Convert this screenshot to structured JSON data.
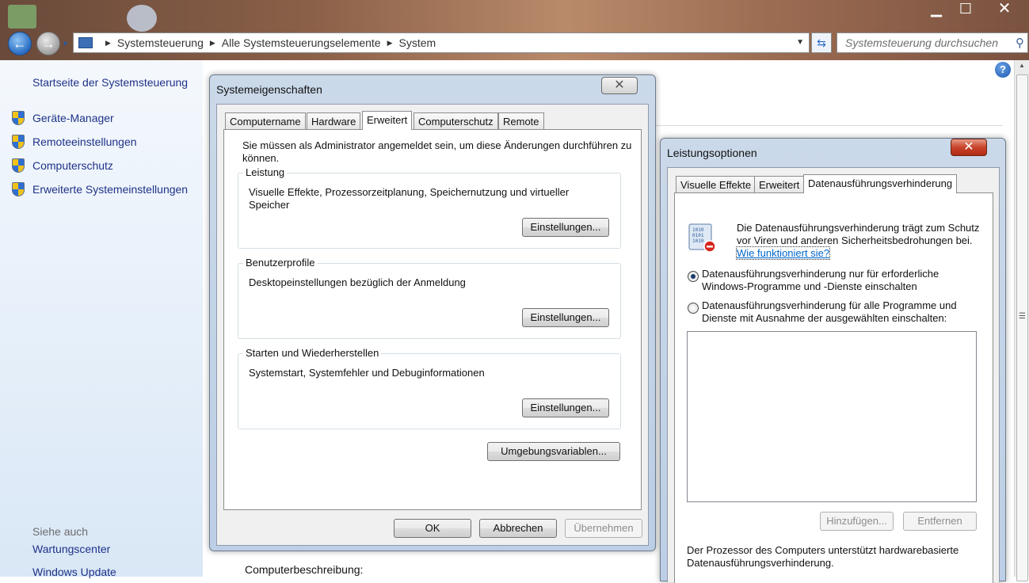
{
  "window": {
    "min_icon": "minimize-icon",
    "max_icon": "maximize-icon",
    "close_icon": "close-icon"
  },
  "addressbar": {
    "crumbs": [
      "Systemsteuerung",
      "Alle Systemsteuerungselemente",
      "System"
    ],
    "search_placeholder": "Systemsteuerung durchsuchen"
  },
  "leftpane": {
    "home": "Startseite der Systemsteuerung",
    "items": [
      "Geräte-Manager",
      "Remoteeinstellungen",
      "Computerschutz",
      "Erweiterte Systemeinstellungen"
    ],
    "see_also": "Siehe auch",
    "see_also_items": [
      "Wartungscenter",
      "Windows Update"
    ]
  },
  "main": {
    "computer_description_label": "Computerbeschreibung:"
  },
  "sysprops": {
    "title": "Systemeigenschaften",
    "tabs": [
      "Computername",
      "Hardware",
      "Erweitert",
      "Computerschutz",
      "Remote"
    ],
    "active_tab": "Erweitert",
    "admin_note": "Sie müssen als Administrator angemeldet sein, um diese Änderungen durchführen zu können.",
    "groups": [
      {
        "legend": "Leistung",
        "desc": "Visuelle Effekte, Prozessorzeitplanung, Speichernutzung und virtueller Speicher",
        "button": "Einstellungen..."
      },
      {
        "legend": "Benutzerprofile",
        "desc": "Desktopeinstellungen bezüglich der Anmeldung",
        "button": "Einstellungen..."
      },
      {
        "legend": "Starten und Wiederherstellen",
        "desc": "Systemstart, Systemfehler und Debuginformationen",
        "button": "Einstellungen..."
      }
    ],
    "env_button": "Umgebungsvariablen...",
    "ok": "OK",
    "cancel": "Abbrechen",
    "apply": "Übernehmen"
  },
  "perfopts": {
    "title": "Leistungsoptionen",
    "tabs": [
      "Visuelle Effekte",
      "Erweitert",
      "Datenausführungsverhinderung"
    ],
    "active_tab": "Datenausführungsverhinderung",
    "info_line1": "Die Datenausführungsverhinderung trägt zum Schutz",
    "info_line2": "vor Viren und anderen Sicherheitsbedrohungen bei.",
    "how_link": "Wie funktioniert sie?",
    "radio1_line1": "Datenausführungsverhinderung nur für erforderliche",
    "radio1_line2": "Windows-Programme und -Dienste einschalten",
    "radio2_line1": "Datenausführungsverhinderung für alle Programme und",
    "radio2_line2": "Dienste mit Ausnahme der ausgewählten einschalten:",
    "selected_radio": 1,
    "add_button": "Hinzufügen...",
    "remove_button": "Entfernen",
    "footer_line1": "Der Prozessor des Computers unterstützt hardwarebasierte",
    "footer_line2": "Datenausführungsverhinderung."
  }
}
